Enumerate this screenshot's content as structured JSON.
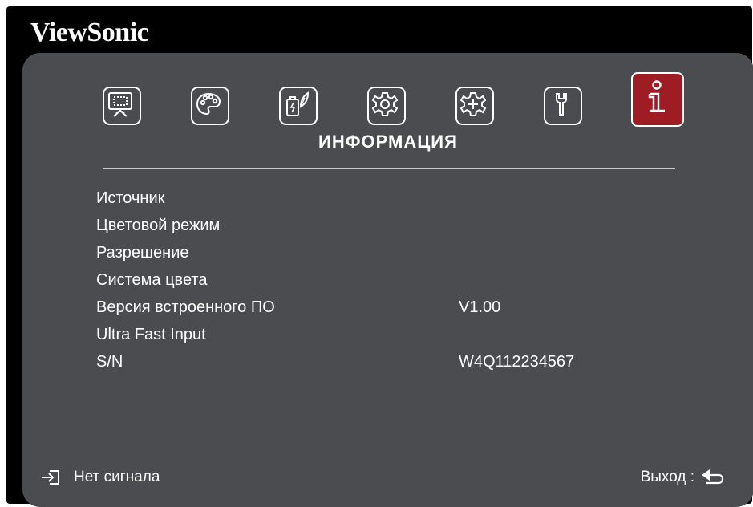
{
  "brand": "ViewSonic",
  "menu": {
    "tabs": [
      {
        "id": "display",
        "icon": "display-icon",
        "active": false
      },
      {
        "id": "image",
        "icon": "palette-icon",
        "active": false
      },
      {
        "id": "power",
        "icon": "power-management-icon",
        "active": false
      },
      {
        "id": "basic",
        "icon": "basic-settings-gear-icon",
        "active": false
      },
      {
        "id": "advanced",
        "icon": "advanced-settings-gear-icon",
        "active": false
      },
      {
        "id": "service",
        "icon": "wrench-icon",
        "active": false
      },
      {
        "id": "information",
        "icon": "info-icon",
        "active": true
      }
    ],
    "section_title": "ИНФОРМАЦИЯ"
  },
  "info": {
    "rows": [
      {
        "label": "Источник",
        "value": ""
      },
      {
        "label": "Цветовой режим",
        "value": ""
      },
      {
        "label": "Разрешение",
        "value": ""
      },
      {
        "label": "Система цвета",
        "value": ""
      },
      {
        "label": "Версия встроенного ПО",
        "value": "V1.00"
      },
      {
        "label": "Ultra Fast Input",
        "value": ""
      },
      {
        "label": "S/N",
        "value": "W4Q112234567"
      }
    ]
  },
  "footer": {
    "input_icon": "input-source-icon",
    "status": "Нет сигнала",
    "exit_label": "Выход :",
    "exit_icon": "return-icon"
  },
  "colors": {
    "frame": "#000000",
    "panel": "#4a4c4f",
    "active_tab": "#9e1d24",
    "text": "#ffffff"
  }
}
